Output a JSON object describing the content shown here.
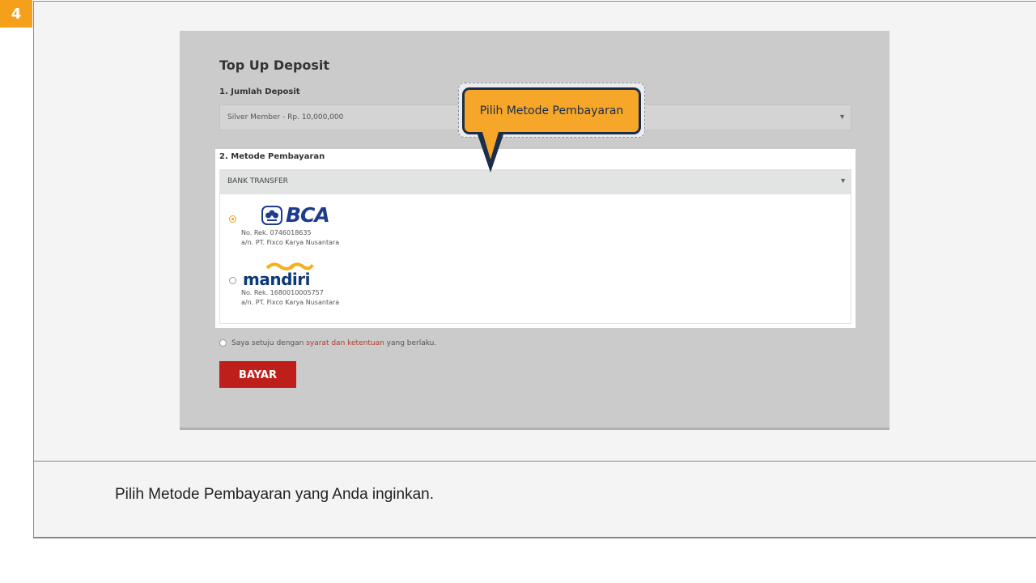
{
  "step": {
    "number": "4"
  },
  "page": {
    "title": "Top Up Deposit",
    "section1": {
      "label": "1. Jumlah Deposit",
      "selected": "Silver Member - Rp. 10,000,000"
    },
    "section2": {
      "label": "2. Metode Pembayaran",
      "selected": "BANK TRANSFER"
    },
    "banks": [
      {
        "name": "BCA",
        "account": "No. Rek. 0746018635",
        "holder": "a/n. PT. Fixco Karya Nusantara",
        "selected": true
      },
      {
        "name": "mandiri",
        "account": "No. Rek. 1680010005757",
        "holder": "a/n. PT. Fixco Karya Nusantara",
        "selected": false
      }
    ],
    "agreement": {
      "prefix": "Saya setuju dengan ",
      "link": "syarat dan ketentuan",
      "suffix": " yang berlaku."
    },
    "submit_label": "BAYAR"
  },
  "callout": {
    "text": "Pilih Metode Pembayaran"
  },
  "caption": "Pilih Metode Pembayaran yang Anda inginkan.",
  "colors": {
    "accent": "#f5a01a",
    "button": "#be1f1a",
    "navy": "#1c2d4a"
  }
}
